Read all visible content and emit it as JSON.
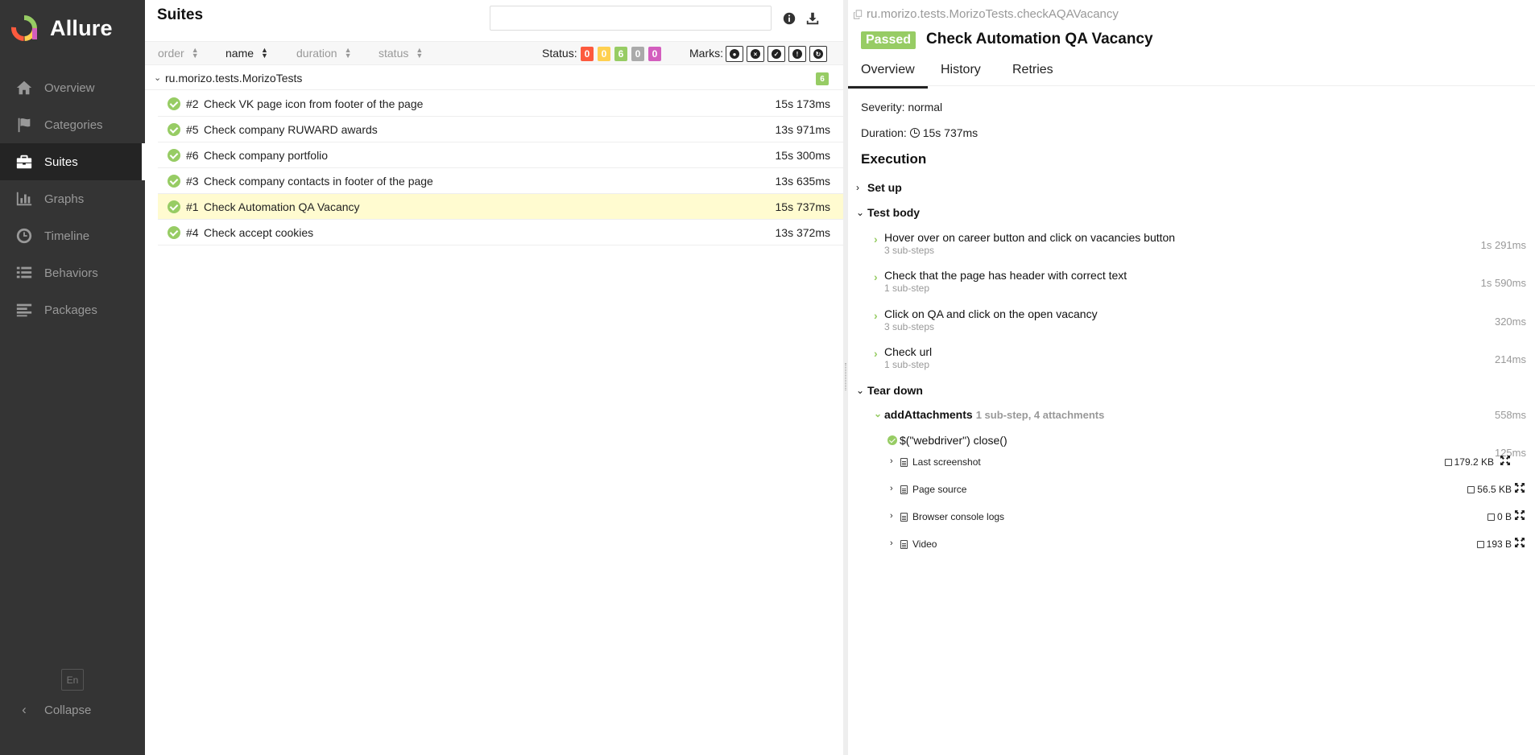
{
  "sidebar": {
    "brand": "Allure",
    "items": [
      {
        "label": "Overview",
        "icon": "home-icon"
      },
      {
        "label": "Categories",
        "icon": "flag-icon"
      },
      {
        "label": "Suites",
        "icon": "briefcase-icon",
        "active": true
      },
      {
        "label": "Graphs",
        "icon": "bar-chart-icon"
      },
      {
        "label": "Timeline",
        "icon": "clock-icon"
      },
      {
        "label": "Behaviors",
        "icon": "list-icon"
      },
      {
        "label": "Packages",
        "icon": "align-left-icon"
      }
    ],
    "language": "En",
    "collapse_label": "Collapse"
  },
  "suites": {
    "title": "Suites",
    "search": {
      "value": "",
      "placeholder": ""
    },
    "sort_columns": [
      {
        "label": "order"
      },
      {
        "label": "name",
        "active": true
      },
      {
        "label": "duration"
      },
      {
        "label": "status"
      }
    ],
    "status_label": "Status:",
    "status_counts": [
      {
        "value": "0",
        "color": "#fd5a3e"
      },
      {
        "value": "0",
        "color": "#ffd050"
      },
      {
        "value": "6",
        "color": "#97cc64"
      },
      {
        "value": "0",
        "color": "#aaaaaa"
      },
      {
        "value": "0",
        "color": "#d35ebe"
      }
    ],
    "marks_label": "Marks:",
    "group": {
      "name": "ru.morizo.tests.MorizoTests",
      "count": "6"
    },
    "tests": [
      {
        "num": "#2",
        "name": "Check VK page icon from footer of the page",
        "duration": "15s 173ms"
      },
      {
        "num": "#5",
        "name": "Check company RUWARD awards",
        "duration": "13s 971ms"
      },
      {
        "num": "#6",
        "name": "Check company portfolio",
        "duration": "15s 300ms"
      },
      {
        "num": "#3",
        "name": "Check company contacts in footer of the page",
        "duration": "13s 635ms"
      },
      {
        "num": "#1",
        "name": "Check Automation QA Vacancy",
        "duration": "15s 737ms",
        "selected": true
      },
      {
        "num": "#4",
        "name": "Check accept cookies",
        "duration": "13s 372ms"
      }
    ]
  },
  "detail": {
    "path": "ru.morizo.tests.MorizoTests.checkAQAVacancy",
    "status": "Passed",
    "title": "Check Automation QA Vacancy",
    "tabs": [
      "Overview",
      "History",
      "Retries"
    ],
    "severity": "Severity: normal",
    "duration_label": "Duration:",
    "duration_value": "15s 737ms",
    "execution_title": "Execution",
    "setup_label": "Set up",
    "body_label": "Test body",
    "steps": [
      {
        "name": "Hover over on career button and click on vacancies button",
        "sub": "3 sub-steps",
        "duration": "1s 291ms"
      },
      {
        "name": "Check that the page has header with correct text",
        "sub": "1 sub-step",
        "duration": "1s 590ms"
      },
      {
        "name": "Click on QA and click on the open vacancy",
        "sub": "3 sub-steps",
        "duration": "320ms"
      },
      {
        "name": "Check url",
        "sub": "1 sub-step",
        "duration": "214ms"
      }
    ],
    "teardown_label": "Tear down",
    "teardown_step": {
      "name": "addAttachments",
      "extra": "1 sub-step, 4 attachments",
      "duration": "558ms"
    },
    "teardown_substep": {
      "name": "$(\"webdriver\") close()",
      "duration": "125ms"
    },
    "attachments": [
      {
        "name": "Last screenshot",
        "size": "179.2 KB"
      },
      {
        "name": "Page source",
        "size": "56.5 KB"
      },
      {
        "name": "Browser console logs",
        "size": "0 B"
      },
      {
        "name": "Video",
        "size": "193 B"
      }
    ]
  },
  "colors": {
    "passed": "#97cc64",
    "sidebar": "#343434",
    "selected_row": "#fffbd0"
  }
}
